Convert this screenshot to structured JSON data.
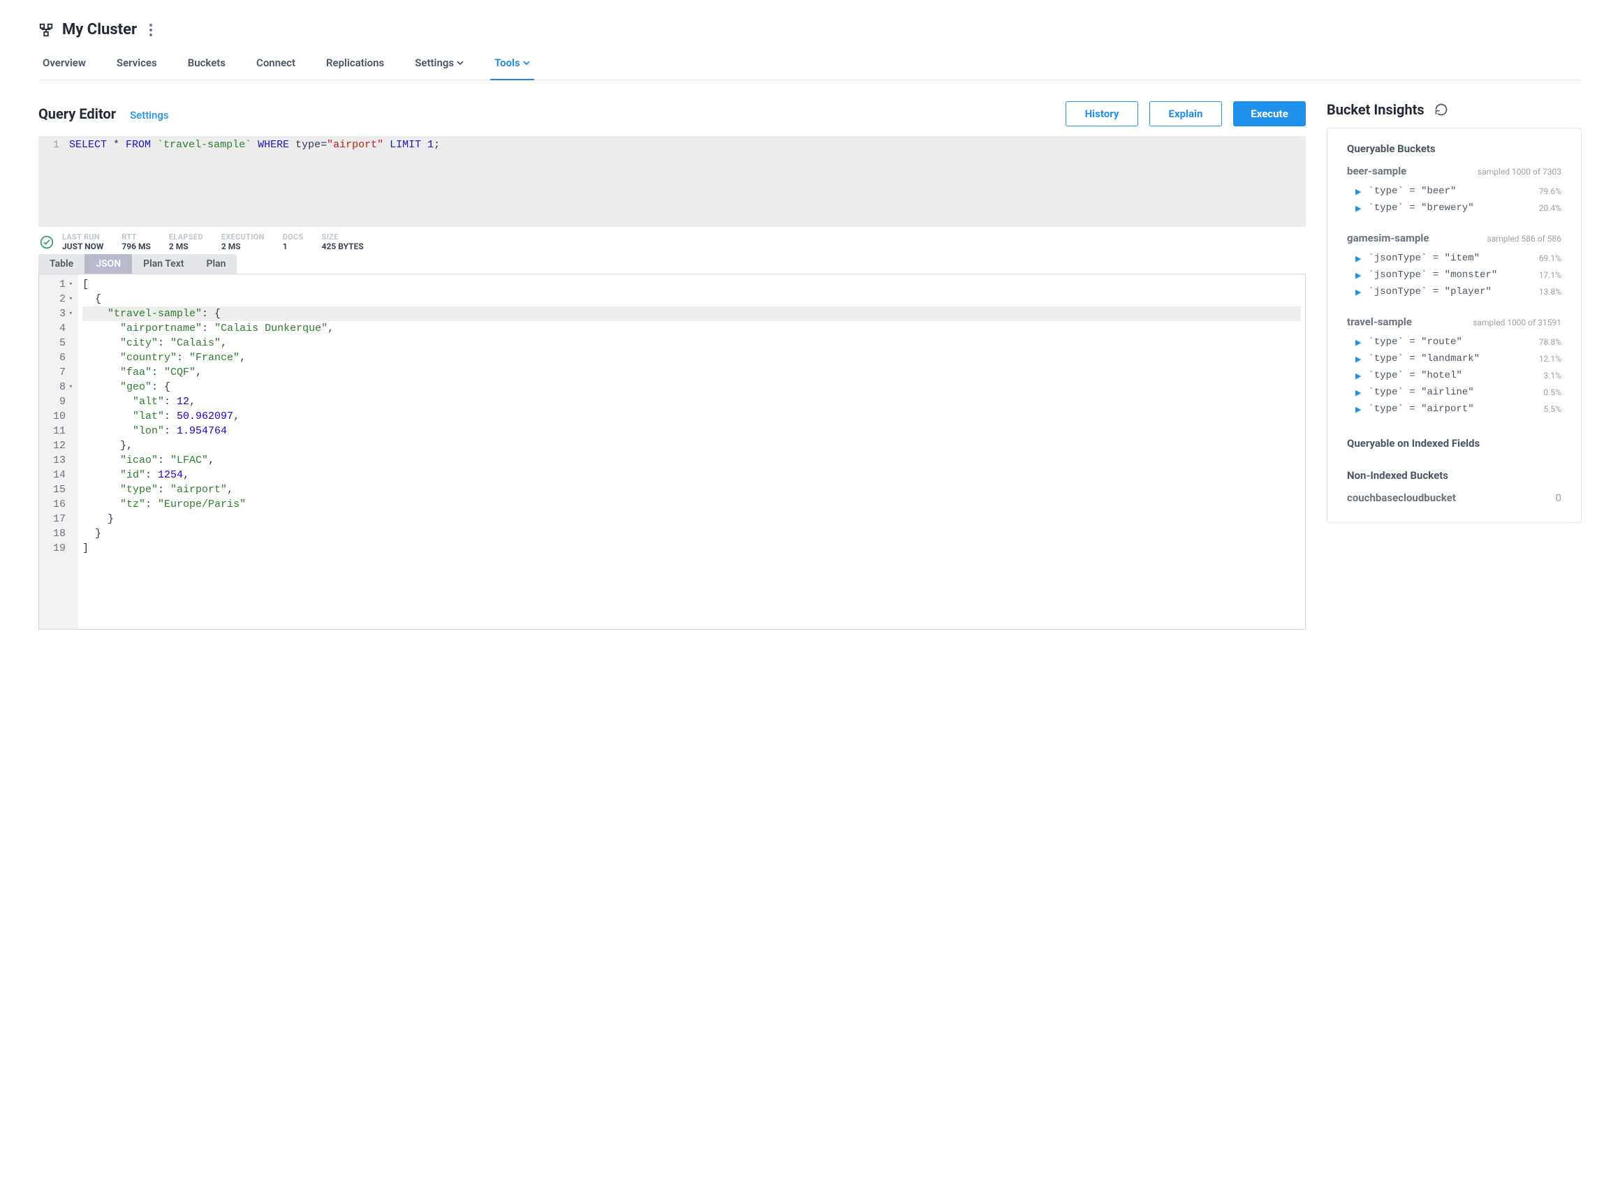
{
  "header": {
    "cluster_name": "My Cluster"
  },
  "nav": {
    "overview": "Overview",
    "services": "Services",
    "buckets": "Buckets",
    "connect": "Connect",
    "replications": "Replications",
    "settings": "Settings",
    "tools": "Tools"
  },
  "query_editor": {
    "title": "Query Editor",
    "settings_link": "Settings",
    "history_btn": "History",
    "explain_btn": "Explain",
    "execute_btn": "Execute",
    "line_number": "1",
    "sql_parts": {
      "select": "SELECT",
      "star": " * ",
      "from": "FROM",
      "table": " `travel-sample` ",
      "where": "WHERE",
      "type_expr": " type=",
      "type_val": "\"airport\"",
      "limit": " LIMIT",
      "limit_val": " 1",
      "semi": ";"
    }
  },
  "stats": {
    "last_run_label": "LAST RUN",
    "last_run_value": "JUST NOW",
    "rtt_label": "RTT",
    "rtt_value": "796 MS",
    "elapsed_label": "ELAPSED",
    "elapsed_value": "2 MS",
    "execution_label": "EXECUTION",
    "execution_value": "2 MS",
    "docs_label": "DOCS",
    "docs_value": "1",
    "size_label": "SIZE",
    "size_value": "425 BYTES"
  },
  "result_tabs": {
    "table": "Table",
    "json": "JSON",
    "plan_text": "Plan Text",
    "plan": "Plan"
  },
  "json_lines": {
    "l1": "[",
    "l2": "  {",
    "l3a": "    ",
    "l3key": "\"travel-sample\"",
    "l3b": ": {",
    "l4a": "      ",
    "l4key": "\"airportname\"",
    "l4m": ": ",
    "l4val": "\"Calais Dunkerque\"",
    "l4e": ",",
    "l5a": "      ",
    "l5key": "\"city\"",
    "l5m": ": ",
    "l5val": "\"Calais\"",
    "l5e": ",",
    "l6a": "      ",
    "l6key": "\"country\"",
    "l6m": ": ",
    "l6val": "\"France\"",
    "l6e": ",",
    "l7a": "      ",
    "l7key": "\"faa\"",
    "l7m": ": ",
    "l7val": "\"CQF\"",
    "l7e": ",",
    "l8a": "      ",
    "l8key": "\"geo\"",
    "l8b": ": {",
    "l9a": "        ",
    "l9key": "\"alt\"",
    "l9m": ": ",
    "l9val": "12",
    "l9e": ",",
    "l10a": "        ",
    "l10key": "\"lat\"",
    "l10m": ": ",
    "l10val": "50.962097",
    "l10e": ",",
    "l11a": "        ",
    "l11key": "\"lon\"",
    "l11m": ": ",
    "l11val": "1.954764",
    "l12": "      },",
    "l13a": "      ",
    "l13key": "\"icao\"",
    "l13m": ": ",
    "l13val": "\"LFAC\"",
    "l13e": ",",
    "l14a": "      ",
    "l14key": "\"id\"",
    "l14m": ": ",
    "l14val": "1254",
    "l14e": ",",
    "l15a": "      ",
    "l15key": "\"type\"",
    "l15m": ": ",
    "l15val": "\"airport\"",
    "l15e": ",",
    "l16a": "      ",
    "l16key": "\"tz\"",
    "l16m": ": ",
    "l16val": "\"Europe/Paris\"",
    "l17": "    }",
    "l18": "  }",
    "l19": "]"
  },
  "insights": {
    "title": "Bucket Insights",
    "queryable_title": "Queryable Buckets",
    "buckets": [
      {
        "name": "beer-sample",
        "sampled": "sampled 1000 of 7303",
        "types": [
          {
            "expr": "`type` = \"beer\"",
            "pct": "79.6%"
          },
          {
            "expr": "`type` = \"brewery\"",
            "pct": "20.4%"
          }
        ]
      },
      {
        "name": "gamesim-sample",
        "sampled": "sampled 586 of 586",
        "types": [
          {
            "expr": "`jsonType` = \"item\"",
            "pct": "69.1%"
          },
          {
            "expr": "`jsonType` = \"monster\"",
            "pct": "17.1%"
          },
          {
            "expr": "`jsonType` = \"player\"",
            "pct": "13.8%"
          }
        ]
      },
      {
        "name": "travel-sample",
        "sampled": "sampled 1000 of 31591",
        "types": [
          {
            "expr": "`type` = \"route\"",
            "pct": "78.8%"
          },
          {
            "expr": "`type` = \"landmark\"",
            "pct": "12.1%"
          },
          {
            "expr": "`type` = \"hotel\"",
            "pct": "3.1%"
          },
          {
            "expr": "`type` = \"airline\"",
            "pct": "0.5%"
          },
          {
            "expr": "`type` = \"airport\"",
            "pct": "5.5%"
          }
        ]
      }
    ],
    "indexed_title": "Queryable on Indexed Fields",
    "nonindexed_title": "Non-Indexed Buckets",
    "nonindexed_bucket": "couchbasecloudbucket",
    "nonindexed_count": "0"
  }
}
